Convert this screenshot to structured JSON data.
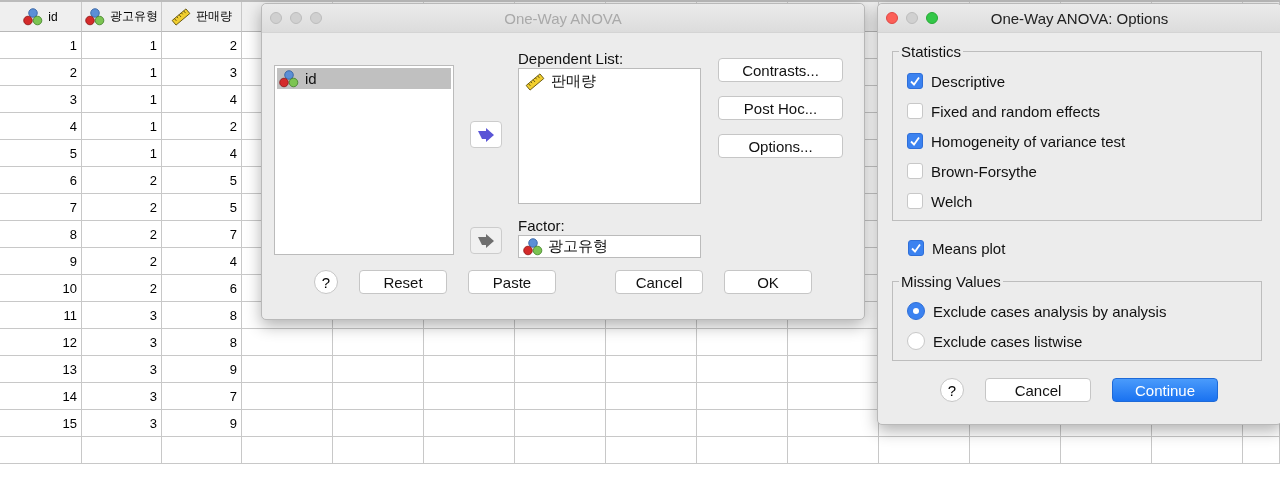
{
  "data_view": {
    "columns": [
      {
        "name": "id",
        "kind": "nominal"
      },
      {
        "name": "광고유형",
        "kind": "nominal"
      },
      {
        "name": "판매량",
        "kind": "scale"
      }
    ],
    "rows": [
      [
        "1",
        "1",
        "2"
      ],
      [
        "2",
        "1",
        "3"
      ],
      [
        "3",
        "1",
        "4"
      ],
      [
        "4",
        "1",
        "2"
      ],
      [
        "5",
        "1",
        "4"
      ],
      [
        "6",
        "2",
        "5"
      ],
      [
        "7",
        "2",
        "5"
      ],
      [
        "8",
        "2",
        "7"
      ],
      [
        "9",
        "2",
        "4"
      ],
      [
        "10",
        "2",
        "6"
      ],
      [
        "11",
        "3",
        "8"
      ],
      [
        "12",
        "3",
        "8"
      ],
      [
        "13",
        "3",
        "9"
      ],
      [
        "14",
        "3",
        "7"
      ],
      [
        "15",
        "3",
        "9"
      ]
    ]
  },
  "anova_dialog": {
    "title": "One-Way ANOVA",
    "active": false,
    "source_list": [
      {
        "name": "id",
        "kind": "nominal",
        "selected": true
      }
    ],
    "dependent_label": "Dependent List:",
    "dependent_list": [
      {
        "name": "판매량",
        "kind": "scale"
      }
    ],
    "factor_label": "Factor:",
    "factor": {
      "name": "광고유형",
      "kind": "nominal"
    },
    "arrow_buttons": [
      {
        "disabled": false
      },
      {
        "disabled": true
      }
    ],
    "side_buttons": [
      "Contrasts...",
      "Post Hoc...",
      "Options..."
    ],
    "help": "?",
    "buttons": [
      "Reset",
      "Paste",
      "Cancel",
      "OK"
    ]
  },
  "options_dialog": {
    "title": "One-Way ANOVA: Options",
    "active": true,
    "statistics": {
      "label": "Statistics",
      "items": [
        {
          "label": "Descriptive",
          "checked": true
        },
        {
          "label": "Fixed and random effects",
          "checked": false
        },
        {
          "label": "Homogeneity of variance test",
          "checked": true
        },
        {
          "label": "Brown-Forsythe",
          "checked": false
        },
        {
          "label": "Welch",
          "checked": false
        }
      ]
    },
    "means_plot": {
      "label": "Means plot",
      "checked": true
    },
    "missing_values": {
      "label": "Missing Values",
      "options": [
        {
          "label": "Exclude cases analysis by analysis",
          "selected": true
        },
        {
          "label": "Exclude cases listwise",
          "selected": false
        }
      ]
    },
    "help": "?",
    "buttons": [
      {
        "label": "Cancel",
        "default": false
      },
      {
        "label": "Continue",
        "default": true
      }
    ]
  }
}
